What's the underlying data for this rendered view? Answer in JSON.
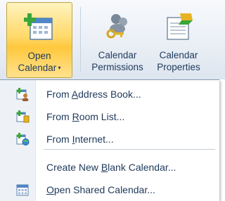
{
  "ribbon": {
    "open_calendar": {
      "line1": "Open",
      "line2": "Calendar",
      "icon": "calendar-add-icon"
    },
    "calendar_permissions": {
      "line1": "Calendar",
      "line2": "Permissions",
      "icon": "permissions-keys-icon"
    },
    "calendar_properties": {
      "line1": "Calendar",
      "line2": "Properties",
      "icon": "calendar-properties-icon"
    }
  },
  "menu": {
    "items": [
      {
        "pre": "From ",
        "key": "A",
        "post": "ddress Book...",
        "icon": "address-book-calendar-icon"
      },
      {
        "pre": "From ",
        "key": "R",
        "post": "oom List...",
        "icon": "room-list-calendar-icon"
      },
      {
        "pre": "From ",
        "key": "I",
        "post": "nternet...",
        "icon": "internet-calendar-icon"
      },
      {
        "pre": "Create New ",
        "key": "B",
        "post": "lank Calendar..."
      },
      {
        "pre": "",
        "key": "O",
        "post": "pen Shared Calendar...",
        "icon": "shared-calendar-icon"
      }
    ]
  },
  "colors": {
    "highlight": "#ffd96a",
    "text": "#1e395b"
  }
}
